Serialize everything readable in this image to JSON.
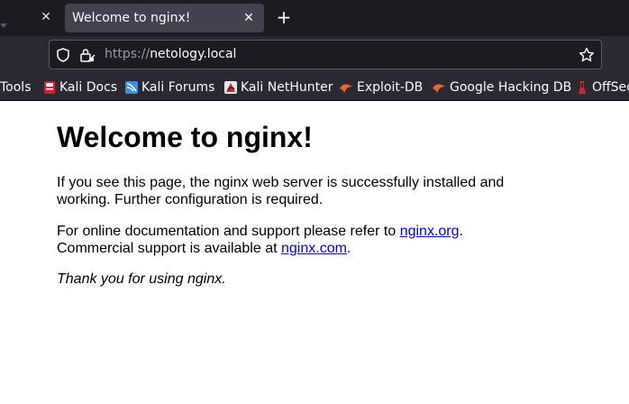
{
  "browser": {
    "tab": {
      "title": "Welcome to nginx!"
    },
    "address": {
      "scheme": "https://",
      "host": "netology.local"
    },
    "bookmarks": [
      {
        "label": "Tools",
        "icon": "none"
      },
      {
        "label": "Kali Docs",
        "icon": "kali-docs-icon"
      },
      {
        "label": "Kali Forums",
        "icon": "kali-forums-icon"
      },
      {
        "label": "Kali NetHunter",
        "icon": "kali-nethunter-icon"
      },
      {
        "label": "Exploit-DB",
        "icon": "exploit-db-icon"
      },
      {
        "label": "Google Hacking DB",
        "icon": "google-hacking-db-icon"
      },
      {
        "label": "OffSec",
        "icon": "offsec-icon"
      }
    ],
    "colors": {
      "chrome_dark": "#1c1b22",
      "chrome": "#2b2a33",
      "active_tab": "#42414d",
      "link": "#0000ee"
    }
  },
  "page": {
    "heading": "Welcome to nginx!",
    "p1": "If you see this page, the nginx web server is successfully installed and working. Further configuration is required.",
    "p2_before": "For online documentation and support please refer to ",
    "p2_link": "nginx.org",
    "p2_after": ".",
    "p3_before": "Commercial support is available at ",
    "p3_link": "nginx.com",
    "p3_after": ".",
    "p4": "Thank you for using nginx."
  }
}
